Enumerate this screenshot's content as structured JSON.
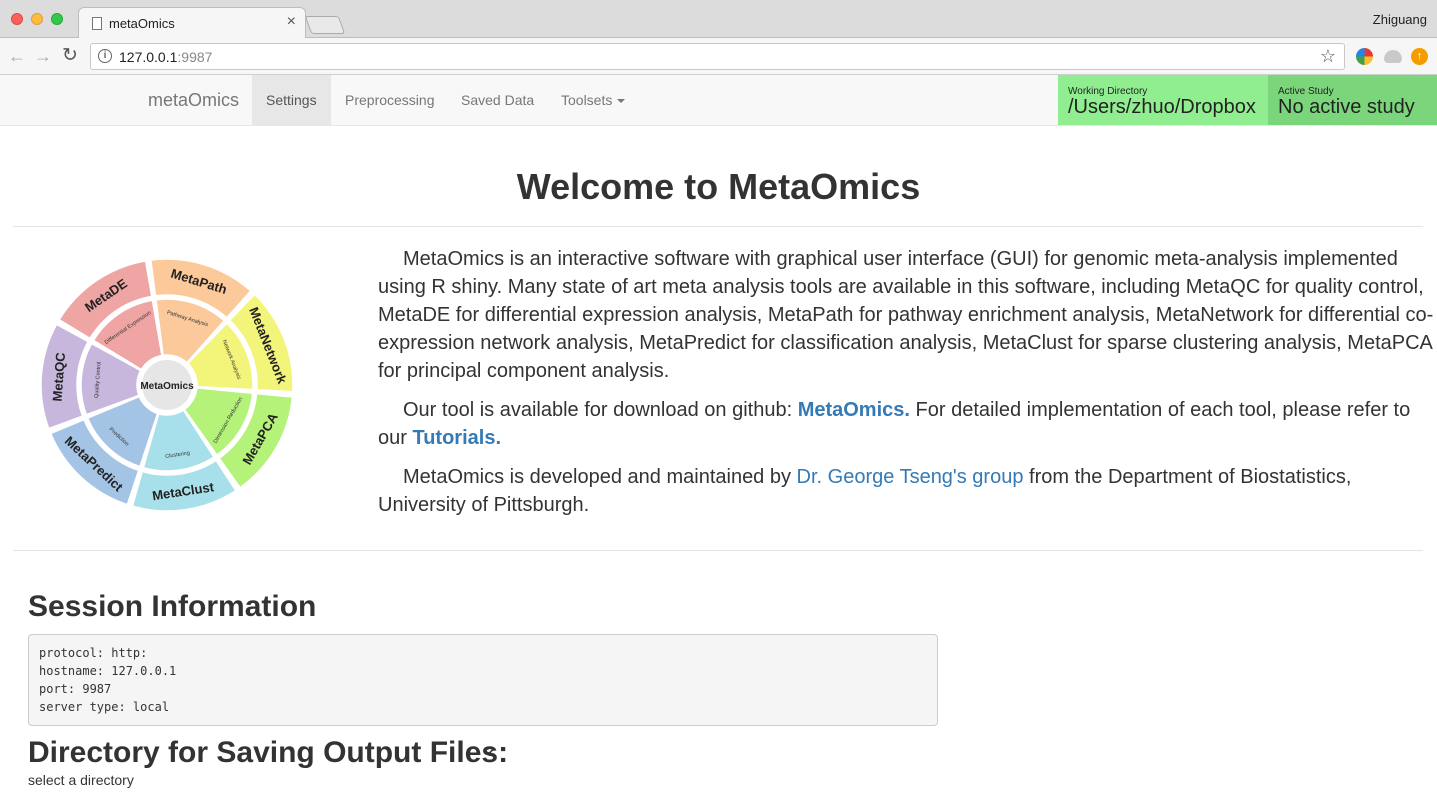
{
  "browser": {
    "tab_title": "metaOmics",
    "tab_close": "×",
    "profile_name": "Zhiguang",
    "url_host": "127.0.0.1",
    "url_port": ":9987",
    "back": "←",
    "forward": "→",
    "reload": "↻",
    "info": "i",
    "star": "☆"
  },
  "navbar": {
    "brand": "metaOmics",
    "links": [
      {
        "label": "Settings",
        "active": true
      },
      {
        "label": "Preprocessing"
      },
      {
        "label": "Saved Data"
      },
      {
        "label": "Toolsets"
      }
    ],
    "working_directory": {
      "label": "Working Directory",
      "value": "/Users/zhuo/Dropbox"
    },
    "active_study": {
      "label": "Active Study",
      "value": "No active study"
    }
  },
  "main": {
    "title": "Welcome to MetaOmics",
    "logo": {
      "center": "MetaOmics",
      "outer_labels": [
        "MetaDE",
        "MetaPath",
        "MetaNetwork",
        "MetaPCA",
        "MetaClust",
        "MetaPredict",
        "MetaQC"
      ],
      "inner_labels": [
        "Differential Expression",
        "Pathway Analysis",
        "Network Analysis",
        "Dimension Reduction",
        "Clustering",
        "Prediction",
        "Quality Control"
      ],
      "colors": [
        "#f0a5a5",
        "#fbc99a",
        "#f3f57a",
        "#b5f27a",
        "#a7e0ea",
        "#a4c4e6",
        "#c7b7dc"
      ]
    },
    "intro": {
      "p1": "MetaOmics is an interactive software with graphical user interface (GUI) for genomic meta-analysis implemented using R shiny. Many state of art meta analysis tools are available in this software, including MetaQC for quality control, MetaDE for differential expression analysis, MetaPath for pathway enrichment analysis, MetaNetwork for differential co-expression network analysis, MetaPredict for classification analysis, MetaClust for sparse clustering analysis, MetaPCA for principal component analysis.",
      "p2_a": "Our tool is available for download on github: ",
      "p2_link1": "MetaOmics.",
      "p2_b": " For detailed implementation of each tool, please refer to our ",
      "p2_link2": "Tutorials.",
      "p3_a": "MetaOmics is developed and maintained by ",
      "p3_link": "Dr. George Tseng's group",
      "p3_b": " from the Department of Biostatistics, University of Pittsburgh."
    },
    "session": {
      "heading": "Session Information",
      "lines": [
        "protocol: http:",
        "hostname: 127.0.0.1",
        "port: 9987",
        "server type: local"
      ]
    },
    "directory": {
      "heading": "Directory for Saving Output Files:",
      "help": "?",
      "select_label": "select a directory"
    }
  }
}
